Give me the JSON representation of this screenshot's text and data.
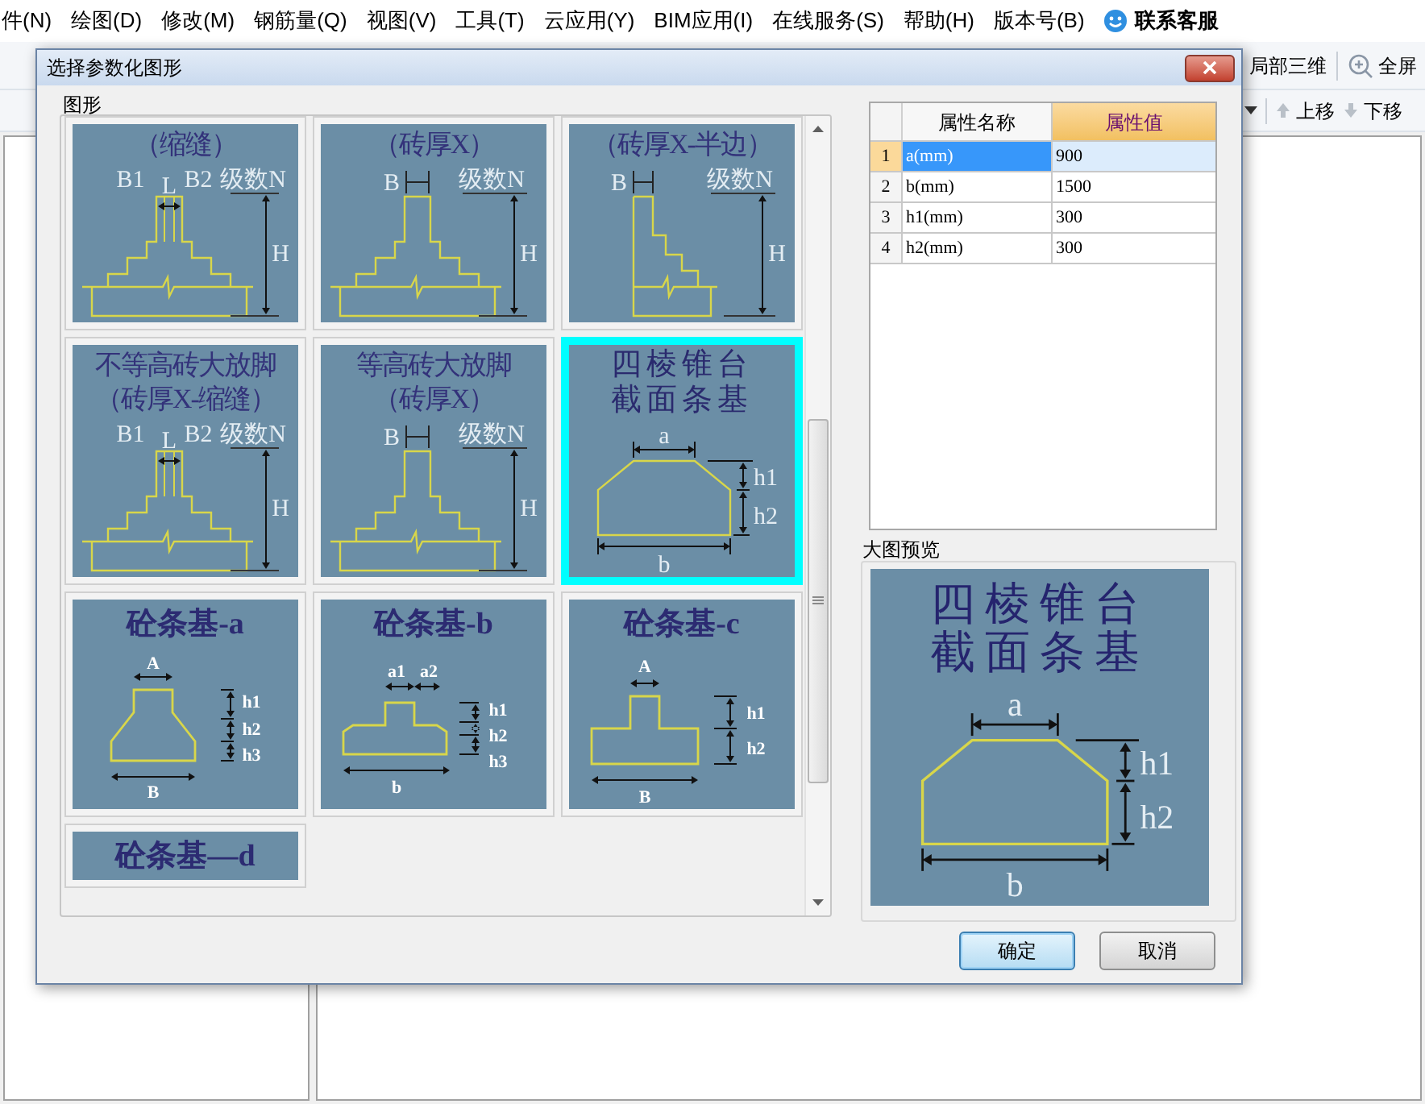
{
  "menu_bar": {
    "items": [
      "件(N)",
      "绘图(D)",
      "修改(M)",
      "钢筋量(Q)",
      "视图(V)",
      "工具(T)",
      "云应用(Y)",
      "BIM应用(I)",
      "在线服务(S)",
      "帮助(H)",
      "版本号(B)"
    ],
    "contact": "联系客服"
  },
  "toolbar": {
    "items": [
      {
        "kind": "text",
        "label": "局部三维"
      },
      {
        "kind": "zoom",
        "label": "全屏"
      }
    ]
  },
  "toolbar2": {
    "items": [
      {
        "kind": "up",
        "label": "上移"
      },
      {
        "kind": "down",
        "label": "下移"
      }
    ]
  },
  "dialog": {
    "title": "选择参数化图形",
    "gallery": {
      "label": "图形",
      "shapes": [
        {
          "kind": "stepped_joint",
          "title": [
            "（缩缝）"
          ],
          "labels": [
            "B1",
            "L",
            "B2",
            "级数N",
            "H"
          ],
          "selected": false
        },
        {
          "kind": "stepped",
          "title": [
            "（砖厚X）"
          ],
          "labels": [
            "B",
            "级数N",
            "H"
          ],
          "selected": false
        },
        {
          "kind": "stepped_half",
          "title": [
            "（砖厚X-半边）"
          ],
          "labels": [
            "B",
            "级数N",
            "H"
          ],
          "selected": false
        },
        {
          "kind": "stepped_joint",
          "title": [
            "不等高砖大放脚",
            "（砖厚X-缩缝）"
          ],
          "labels": [
            "B1",
            "L",
            "B2",
            "级数N",
            "H"
          ],
          "selected": false
        },
        {
          "kind": "stepped",
          "title": [
            "等高砖大放脚",
            "（砖厚X）"
          ],
          "labels": [
            "B",
            "级数N",
            "H"
          ],
          "selected": false
        },
        {
          "kind": "trapezoid",
          "title": [
            "四棱锥台",
            "截面条基"
          ],
          "labels": [
            "a",
            "h1",
            "h2",
            "b"
          ],
          "selected": true
        },
        {
          "kind": "concrete_a",
          "title": [
            "砼条基-a"
          ],
          "labels": [
            "A",
            "h1",
            "h2",
            "h3",
            "B"
          ],
          "selected": false
        },
        {
          "kind": "concrete_b",
          "title": [
            "砼条基-b"
          ],
          "labels": [
            "a1",
            "a2",
            "h1",
            "h2",
            "h3",
            "b"
          ],
          "selected": false
        },
        {
          "kind": "concrete_c",
          "title": [
            "砼条基-c"
          ],
          "labels": [
            "A",
            "h1",
            "h2",
            "B"
          ],
          "selected": false
        },
        {
          "kind": "concrete_d",
          "title": [
            "砼条基—d"
          ],
          "selected": false
        }
      ]
    },
    "properties": {
      "columns": [
        "属性名称",
        "属性值"
      ],
      "rows": [
        {
          "index": "1",
          "name": "a(mm)",
          "value": "900",
          "selected": true
        },
        {
          "index": "2",
          "name": "b(mm)",
          "value": "1500",
          "selected": false
        },
        {
          "index": "3",
          "name": "h1(mm)",
          "value": "300",
          "selected": false
        },
        {
          "index": "4",
          "name": "h2(mm)",
          "value": "300",
          "selected": false
        }
      ]
    },
    "preview": {
      "label": "大图预览",
      "kind": "trapezoid",
      "title": [
        "四棱锥台",
        "截面条基"
      ],
      "labels": [
        "a",
        "h1",
        "h2",
        "b"
      ]
    },
    "buttons": [
      {
        "label": "确定",
        "default": true
      },
      {
        "label": "取消",
        "default": false
      }
    ]
  }
}
